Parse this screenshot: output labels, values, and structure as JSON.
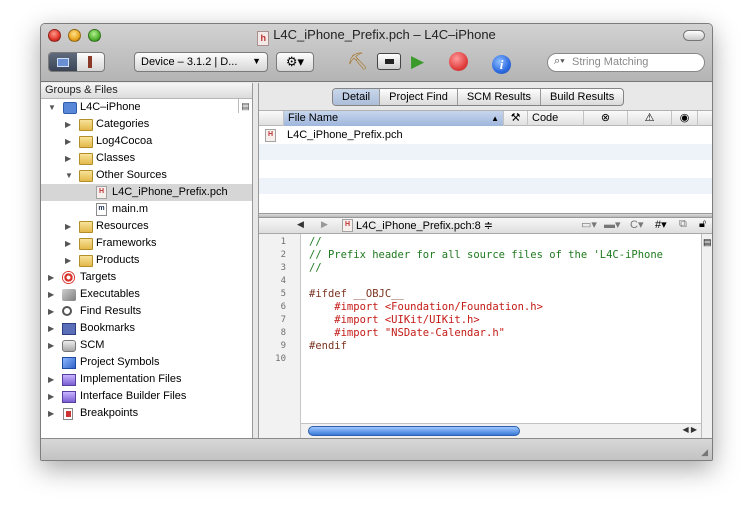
{
  "window": {
    "title": "L4C_iPhone_Prefix.pch – L4C–iPhone",
    "doc_icon": "h"
  },
  "toolbar": {
    "device_popup": "Device – 3.1.2 | D...",
    "search_placeholder": "String Matching",
    "icons": [
      "overview-icon",
      "action-gear-icon",
      "clean-broom-icon",
      "build-icon",
      "build-and-go-icon",
      "stop-icon",
      "info-icon"
    ]
  },
  "sidebar": {
    "header": "Groups & Files",
    "items": [
      {
        "label": "L4C–iPhone",
        "icon": "project-icon"
      },
      {
        "label": "Categories",
        "icon": "folder-icon"
      },
      {
        "label": "Log4Cocoa",
        "icon": "folder-icon"
      },
      {
        "label": "Classes",
        "icon": "folder-icon"
      },
      {
        "label": "Other Sources",
        "icon": "folder-icon"
      },
      {
        "label": "L4C_iPhone_Prefix.pch",
        "icon": "header-file-icon"
      },
      {
        "label": "main.m",
        "icon": "m-file-icon"
      },
      {
        "label": "Resources",
        "icon": "folder-icon"
      },
      {
        "label": "Frameworks",
        "icon": "folder-icon"
      },
      {
        "label": "Products",
        "icon": "folder-icon"
      },
      {
        "label": "Targets",
        "icon": "target-icon"
      },
      {
        "label": "Executables",
        "icon": "executable-icon"
      },
      {
        "label": "Find Results",
        "icon": "magnifier-icon"
      },
      {
        "label": "Bookmarks",
        "icon": "bookmark-icon"
      },
      {
        "label": "SCM",
        "icon": "scm-icon"
      },
      {
        "label": "Project Symbols",
        "icon": "cube-icon"
      },
      {
        "label": "Implementation Files",
        "icon": "smart-group-icon"
      },
      {
        "label": "Interface Builder Files",
        "icon": "smart-group-icon"
      },
      {
        "label": "Breakpoints",
        "icon": "breakpoint-icon"
      }
    ]
  },
  "detail": {
    "tabs": [
      "Detail",
      "Project Find",
      "SCM Results",
      "Build Results"
    ],
    "active_tab": "Detail",
    "columns": [
      "File Name",
      "Code"
    ],
    "rows": [
      {
        "file_name": "L4C_iPhone_Prefix.pch"
      }
    ]
  },
  "editor": {
    "nav_file": "L4C_iPhone_Prefix.pch:8 ≑",
    "line_numbers": [
      "1",
      "2",
      "3",
      "4",
      "5",
      "6",
      "7",
      "8",
      "9",
      "10"
    ],
    "lines": [
      "//",
      "// Prefix header for all source files of the 'L4C-iPhone",
      "//",
      "",
      "#ifdef __OBJC__",
      "    #import <Foundation/Foundation.h>",
      "    #import <UIKit/UIKit.h>",
      "    #import \"NSDate-Calendar.h\"",
      "#endif",
      ""
    ]
  }
}
